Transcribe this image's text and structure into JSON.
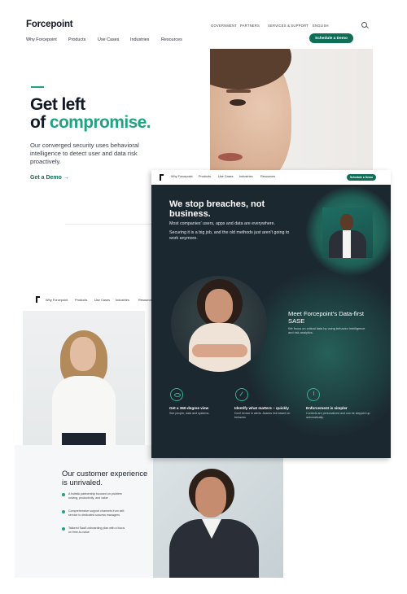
{
  "page1": {
    "logo": "Forcepoint",
    "util": {
      "government": "GOVERNMENT",
      "partners": "PARTNERS",
      "services": "SERVICES & SUPPORT",
      "language": "ENGLISH"
    },
    "nav": [
      "Why Forcepoint",
      "Products",
      "Use Cases",
      "Industries",
      "Resources"
    ],
    "demo_button": "Schedule a Demo",
    "hero": {
      "title_line1": "Get left",
      "title_of": "of",
      "title_accent": "compromise.",
      "description": "Our converged security uses behavioral intelligence to detect user and data risk proactively.",
      "cta": "Get a Demo →"
    }
  },
  "page2": {
    "nav": [
      "Why Forcepoint",
      "Products",
      "Use Cases",
      "Industries",
      "Resources"
    ],
    "demo_button": "Schedule a Demo",
    "title": "We stop breaches, not business.",
    "text1": "Most companies' users, apps and data are everywhere.",
    "text2": "Securing it is a big job, and the old methods just aren't going to work anymore.",
    "meet_title": "Meet Forcepoint's Data-first SASE",
    "meet_sub": "We focus on critical data by using behavior intelligence and risk analytics.",
    "features": [
      {
        "icon": "eye-icon",
        "title": "Get a 360-degree view",
        "desc": "See people, data and systems."
      },
      {
        "icon": "gauge-icon",
        "title": "Identify what matters – quickly",
        "desc": "Don't drown in alerts. Assess risk based on behavior."
      },
      {
        "icon": "clock-icon",
        "title": "Enforcement is simpler",
        "desc": "Controls are personalized and can be stepped up automatically."
      }
    ]
  },
  "page3": {
    "nav": [
      "Why Forcepoint",
      "Products",
      "Use Cases",
      "Industries",
      "Resources"
    ],
    "heading": "Our customer experience is unrivaled.",
    "bullets": [
      "A holistic partnership focused on problem solving, productivity, and value",
      "Comprehensive support channels from self-service to dedicated success managers",
      "Tailored SaaS onboarding plan with a focus on time-to-value"
    ]
  },
  "colors": {
    "brand_green": "#0f6e58",
    "accent_green": "#1fa383",
    "dark_bg": "#1c2830"
  }
}
